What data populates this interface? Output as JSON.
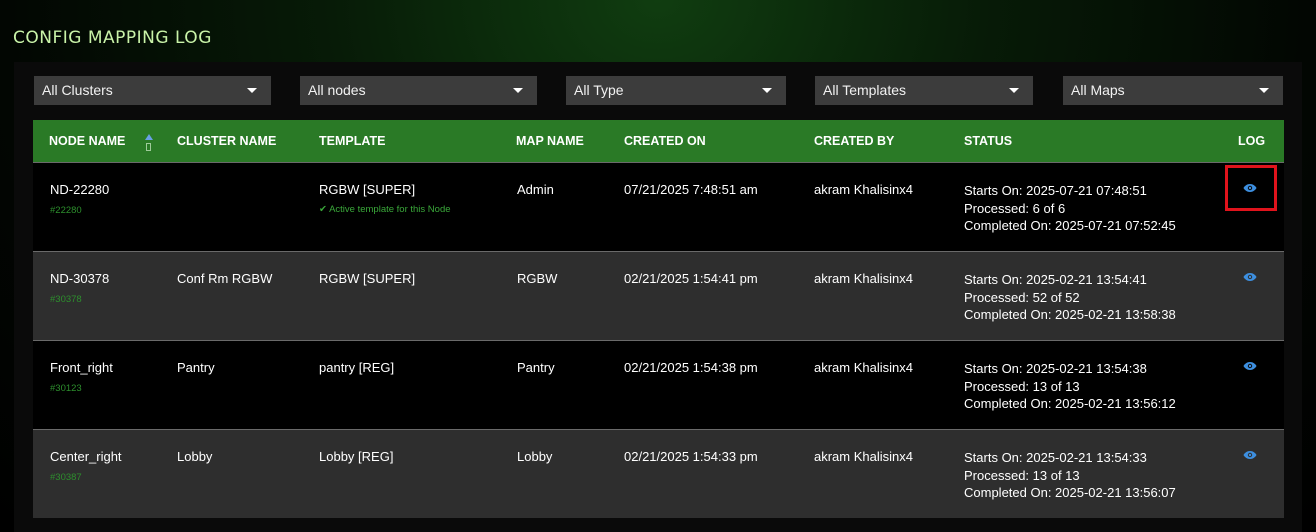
{
  "page": {
    "title": "CONFIG MAPPING LOG"
  },
  "filters": [
    {
      "label": "All Clusters"
    },
    {
      "label": "All nodes"
    },
    {
      "label": "All Type"
    },
    {
      "label": "All Templates"
    },
    {
      "label": "All Maps"
    }
  ],
  "table": {
    "columns": [
      "NODE NAME",
      "CLUSTER NAME",
      "TEMPLATE",
      "MAP NAME",
      "CREATED ON",
      "CREATED BY",
      "STATUS",
      "LOG"
    ],
    "rows": [
      {
        "node_name": "ND-22280",
        "node_id": "#22280",
        "cluster_name": "",
        "template": "RGBW [SUPER]",
        "template_note": "✔ Active template for this Node",
        "map_name": "Admin",
        "created_on": "07/21/2025 7:48:51 am",
        "created_by": "akram Khalisinx4",
        "status_start": "Starts On: 2025-07-21 07:48:51",
        "status_processed": "Processed: 6 of 6",
        "status_completed": "Completed On: 2025-07-21 07:52:45"
      },
      {
        "node_name": "ND-30378",
        "node_id": "#30378",
        "cluster_name": "Conf Rm RGBW",
        "template": "RGBW [SUPER]",
        "map_name": "RGBW",
        "created_on": "02/21/2025 1:54:41 pm",
        "created_by": "akram Khalisinx4",
        "status_start": "Starts On: 2025-02-21 13:54:41",
        "status_processed": "Processed: 52 of 52",
        "status_completed": "Completed On: 2025-02-21 13:58:38"
      },
      {
        "node_name": "Front_right",
        "node_id": "#30123",
        "cluster_name": "Pantry",
        "template": "pantry [REG]",
        "map_name": "Pantry",
        "created_on": "02/21/2025 1:54:38 pm",
        "created_by": "akram Khalisinx4",
        "status_start": "Starts On: 2025-02-21 13:54:38",
        "status_processed": "Processed: 13 of 13",
        "status_completed": "Completed On: 2025-02-21 13:56:12"
      },
      {
        "node_name": "Center_right",
        "node_id": "#30387",
        "cluster_name": "Lobby",
        "template": "Lobby [REG]",
        "map_name": "Lobby",
        "created_on": "02/21/2025 1:54:33 pm",
        "created_by": "akram Khalisinx4",
        "status_start": "Starts On: 2025-02-21 13:54:33",
        "status_processed": "Processed: 13 of 13",
        "status_completed": "Completed On: 2025-02-21 13:56:07"
      }
    ]
  },
  "icons": {
    "sort": "sort-asc-icon",
    "log": "eye-icon"
  },
  "colors": {
    "header_bg": "#2a7a26",
    "accent_green": "#2d8f2d",
    "eye_blue": "#3d8fe0",
    "highlight_red": "#e0131c"
  }
}
